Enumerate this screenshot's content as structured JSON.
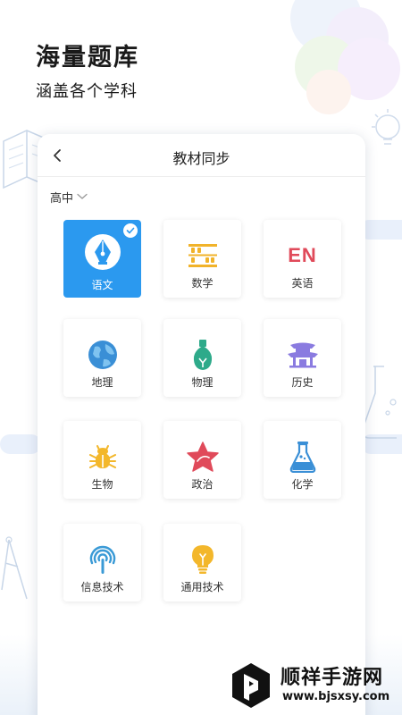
{
  "promo": {
    "headline": "海量题库",
    "subline": "涵盖各个学科"
  },
  "card": {
    "title": "教材同步",
    "grade": {
      "selected": "高中"
    },
    "subjects": [
      {
        "label": "语文",
        "icon": "pen-nib-icon",
        "selected": true
      },
      {
        "label": "数学",
        "icon": "abacus-icon",
        "selected": false
      },
      {
        "label": "英语",
        "icon": "en-icon",
        "icon_text": "EN",
        "selected": false
      },
      {
        "label": "地理",
        "icon": "globe-icon",
        "selected": false
      },
      {
        "label": "物理",
        "icon": "light-bulb-icon",
        "selected": false
      },
      {
        "label": "历史",
        "icon": "pavilion-icon",
        "selected": false
      },
      {
        "label": "生物",
        "icon": "bug-icon",
        "selected": false
      },
      {
        "label": "政治",
        "icon": "star-icon",
        "selected": false
      },
      {
        "label": "化学",
        "icon": "flask-icon",
        "selected": false
      },
      {
        "label": "信息技术",
        "icon": "wireless-icon",
        "selected": false
      },
      {
        "label": "通用技术",
        "icon": "bulb-icon",
        "selected": false
      }
    ]
  },
  "watermark": {
    "title": "顺祥手游网",
    "url": "www.bjsxsy.com"
  },
  "colors": {
    "accent": "#2b99ef",
    "math": "#f1b32a",
    "english": "#e04a5a",
    "geography": "#3a8fd6",
    "physics": "#2eaa8a",
    "history": "#8a7be0",
    "biology": "#f3b72b",
    "politics": "#e04a5a",
    "chemistry": "#3a8fd6",
    "info_tech": "#3a9ad6",
    "general_tech": "#f3b72b"
  }
}
